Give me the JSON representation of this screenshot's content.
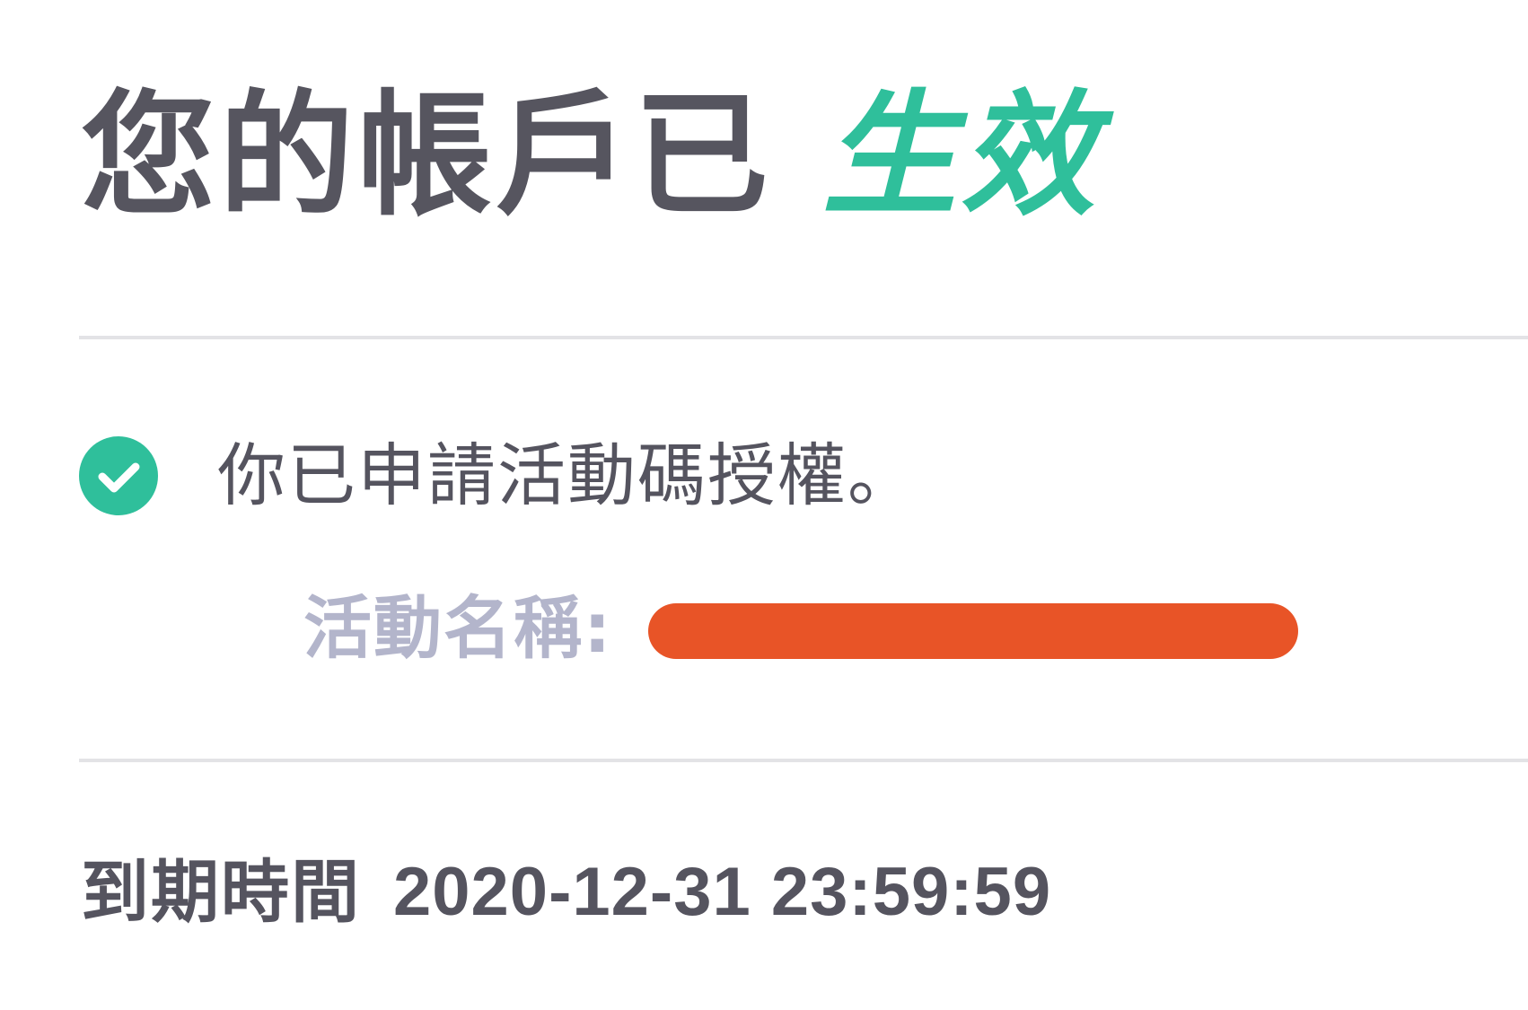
{
  "account": {
    "title_prefix": "您的帳戶已",
    "status": "生效"
  },
  "notice": {
    "text": "你已申請活動碼授權。",
    "icon": "check-circle-icon"
  },
  "activity": {
    "label": "活動名稱:"
  },
  "expiry": {
    "label": "到期時間",
    "value": "2020-12-31 23:59:59"
  },
  "colors": {
    "accent": "#2fbf9b",
    "text": "#55545f",
    "muted_label": "#b3b5cb",
    "redaction": "#e85427",
    "divider": "#e3e3e6"
  }
}
